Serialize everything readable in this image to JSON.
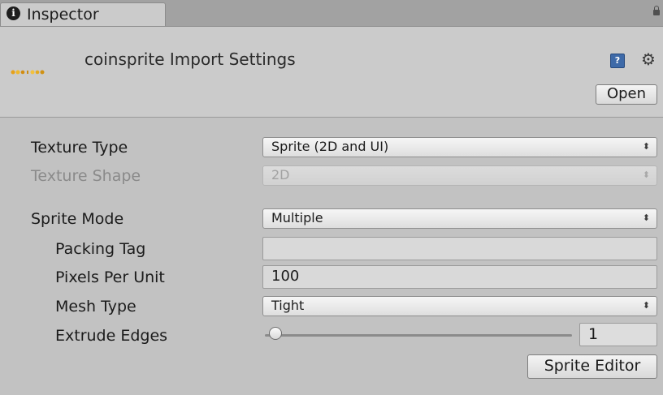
{
  "window": {
    "tab_label": "Inspector",
    "tab_icon": "info-icon"
  },
  "header": {
    "title": "coinsprite Import Settings",
    "open_label": "Open",
    "icons": [
      "help-icon",
      "gear-icon",
      "lock-icon"
    ]
  },
  "settings": {
    "texture_type": {
      "label": "Texture Type",
      "value": "Sprite (2D and UI)"
    },
    "texture_shape": {
      "label": "Texture Shape",
      "value": "2D"
    },
    "sprite_mode": {
      "label": "Sprite Mode",
      "value": "Multiple"
    },
    "packing_tag": {
      "label": "Packing Tag",
      "value": ""
    },
    "pixels_per_unit": {
      "label": "Pixels Per Unit",
      "value": "100"
    },
    "mesh_type": {
      "label": "Mesh Type",
      "value": "Tight"
    },
    "extrude_edges": {
      "label": "Extrude Edges",
      "value": "1",
      "slider_fraction": 0.03
    }
  },
  "sprite_editor_label": "Sprite Editor",
  "colors": {
    "panel": "#c2c2c2",
    "header": "#cbcbcb",
    "help_icon": "#3e6aa8"
  }
}
